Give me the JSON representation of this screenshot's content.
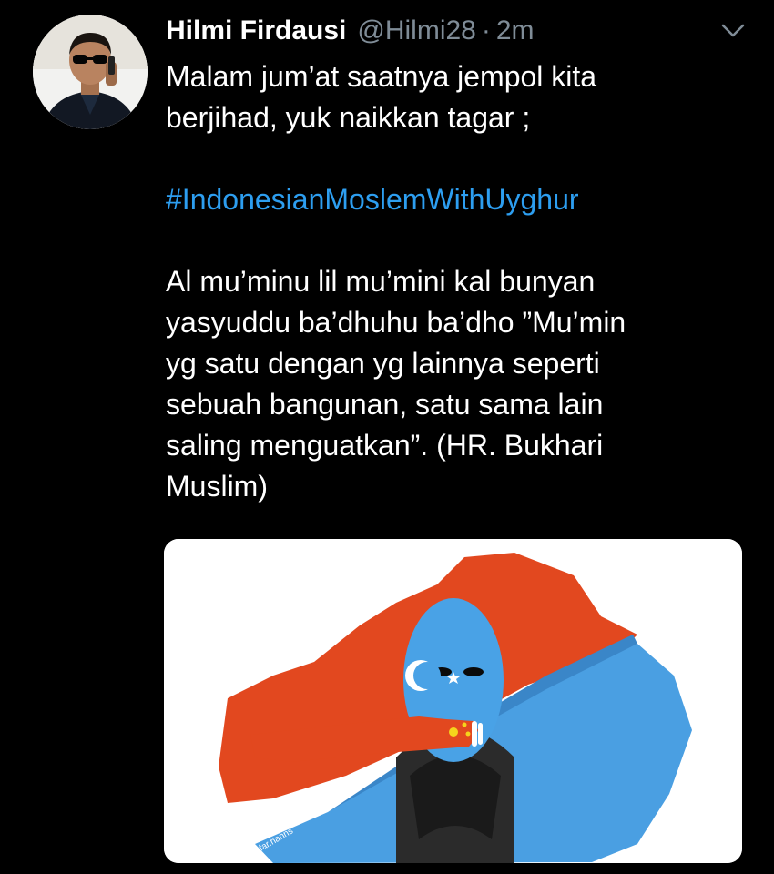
{
  "tweet": {
    "author_name": "Hilmi Firdausi",
    "handle": "@Hilmi28",
    "separator": "·",
    "time": "2m",
    "text_line1": "Malam jum’at saatnya jempol kita",
    "text_line2": "berjihad, yuk naikkan tagar ;",
    "hashtag": "#IndonesianMoslemWithUyghur",
    "quote_line1": "Al mu’minu lil mu’mini kal bunyan",
    "quote_line2": "yasyuddu ba’dhuhu ba’dho ”Mu’min",
    "quote_line3": "yg satu dengan yg lainnya seperti",
    "quote_line4": "sebuah bangunan, satu sama lain",
    "quote_line5": "saling menguatkan”. (HR. Bukhari",
    "quote_line6": "Muslim)",
    "media_watermark": "@far.hanns"
  },
  "colors": {
    "background": "#000000",
    "hashtag": "#2d9ef0",
    "muted": "#7f8c97",
    "map_red": "#e2481f",
    "map_blue": "#4a9fe2"
  },
  "icons": {
    "more": "chevron-down-icon"
  }
}
